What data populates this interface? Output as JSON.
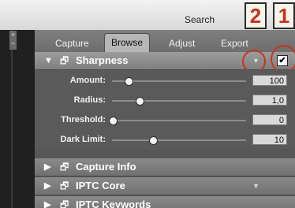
{
  "toolbar": {
    "search_label": "Search"
  },
  "annotations": {
    "callout_1": "1",
    "callout_2": "2"
  },
  "tabs": [
    {
      "label": "Capture"
    },
    {
      "label": "Browse",
      "active": true
    },
    {
      "label": "Adjust"
    },
    {
      "label": "Export"
    }
  ],
  "sections": {
    "sharpness": {
      "title": "Sharpness",
      "expanded": true,
      "checkbox": "✔",
      "sliders": [
        {
          "label": "Amount:",
          "value": "100",
          "fraction": 0.12
        },
        {
          "label": "Radius:",
          "value": "1,0",
          "fraction": 0.2
        },
        {
          "label": "Threshold:",
          "value": "0",
          "fraction": 0.0
        },
        {
          "label": "Dark Limit:",
          "value": "10",
          "fraction": 0.3
        }
      ]
    },
    "capture_info": {
      "title": "Capture Info"
    },
    "iptc_core": {
      "title": "IPTC Core"
    },
    "iptc_keywords": {
      "title": "IPTC Keywords"
    }
  },
  "colors": {
    "callout_red": "#c8331f",
    "panel_gray": "#575757"
  },
  "icons": {
    "expanded": "triangle-down-icon",
    "collapsed": "triangle-right-icon",
    "window": "window-icon",
    "menu": "chevron-down-icon",
    "check": "checkmark-icon"
  }
}
